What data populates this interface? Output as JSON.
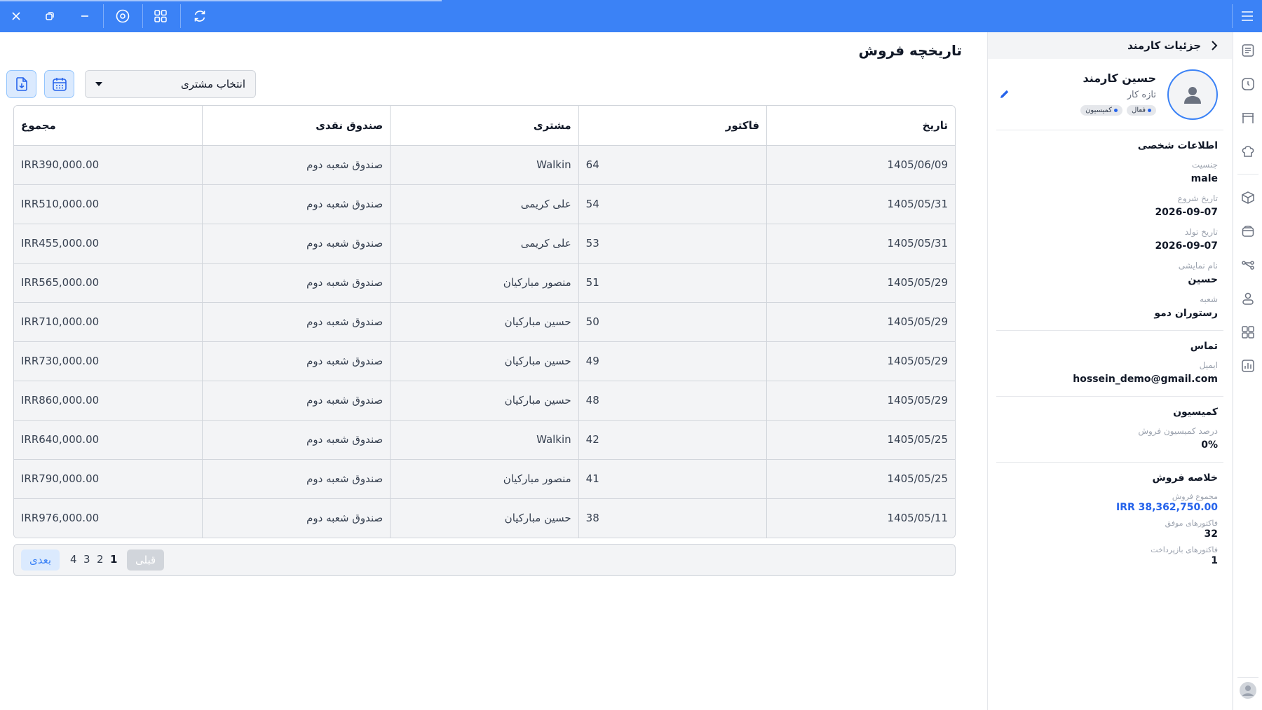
{
  "page": {
    "title": "تاریخچه فروش"
  },
  "filters": {
    "customer_select": "انتخاب مشتری"
  },
  "table": {
    "headers": {
      "date": "تاریخ",
      "invoice": "فاکتور",
      "customer": "مشتری",
      "cashbox": "صندوق نقدی",
      "total": "مجموع"
    },
    "rows": [
      {
        "date": "1405/06/09",
        "invoice": "64",
        "customer": "Walkin",
        "cashbox": "صندوق شعبه دوم",
        "total": "IRR390,000.00"
      },
      {
        "date": "1405/05/31",
        "invoice": "54",
        "customer": "علی کریمی",
        "cashbox": "صندوق شعبه دوم",
        "total": "IRR510,000.00"
      },
      {
        "date": "1405/05/31",
        "invoice": "53",
        "customer": "علی کریمی",
        "cashbox": "صندوق شعبه دوم",
        "total": "IRR455,000.00"
      },
      {
        "date": "1405/05/29",
        "invoice": "51",
        "customer": "منصور مبارکیان",
        "cashbox": "صندوق شعبه دوم",
        "total": "IRR565,000.00"
      },
      {
        "date": "1405/05/29",
        "invoice": "50",
        "customer": "حسین مبارکیان",
        "cashbox": "صندوق شعبه دوم",
        "total": "IRR710,000.00"
      },
      {
        "date": "1405/05/29",
        "invoice": "49",
        "customer": "حسین مبارکیان",
        "cashbox": "صندوق شعبه دوم",
        "total": "IRR730,000.00"
      },
      {
        "date": "1405/05/29",
        "invoice": "48",
        "customer": "حسین مبارکیان",
        "cashbox": "صندوق شعبه دوم",
        "total": "IRR860,000.00"
      },
      {
        "date": "1405/05/25",
        "invoice": "42",
        "customer": "Walkin",
        "cashbox": "صندوق شعبه دوم",
        "total": "IRR640,000.00"
      },
      {
        "date": "1405/05/25",
        "invoice": "41",
        "customer": "منصور مبارکیان",
        "cashbox": "صندوق شعبه دوم",
        "total": "IRR790,000.00"
      },
      {
        "date": "1405/05/11",
        "invoice": "38",
        "customer": "حسین مبارکیان",
        "cashbox": "صندوق شعبه دوم",
        "total": "IRR976,000.00"
      }
    ]
  },
  "pagination": {
    "prev": "قبلی",
    "next": "بعدی",
    "pages": [
      "1",
      "2",
      "3",
      "4"
    ],
    "current": "1"
  },
  "employee": {
    "panel_title": "جزئیات کارمند",
    "name": "حسین کارمند",
    "role": "تازه کار",
    "badges": [
      {
        "label": "فعال",
        "color": "#2563eb"
      },
      {
        "label": "کمیسیون",
        "color": "#2563eb"
      }
    ],
    "personal": {
      "title": "اطلاعات شخصی",
      "gender_label": "جنسیت",
      "gender": "male",
      "start_label": "تاریخ شروع",
      "start": "2026-09-07",
      "birth_label": "تاریخ تولد",
      "birth": "2026-09-07",
      "display_label": "نام نمایشی",
      "display": "حسین",
      "branch_label": "شعبه",
      "branch": "رستوران دمو"
    },
    "contact": {
      "title": "تماس",
      "email_label": "ایمیل",
      "email": "hossein_demo@gmail.com"
    },
    "commission": {
      "title": "کمیسیون",
      "rate_label": "درصد کمیسیون فروش",
      "rate": "0%"
    },
    "sales_summary": {
      "title": "خلاصه فروش",
      "total_label": "مجموع فروش",
      "total": "IRR 38,362,750.00",
      "success_label": "فاکتورهای موفق",
      "success": "32",
      "refund_label": "فاکتورهای بازپرداخت",
      "refund": "1"
    }
  },
  "colors": {
    "accent": "#3b82f6",
    "link": "#2563eb"
  },
  "icons": {
    "topbar": [
      "close-icon",
      "restore-icon",
      "minimize-icon",
      "settings-circle-icon",
      "grid-icon",
      "refresh-icon",
      "menu-icon"
    ],
    "rail": [
      "list-icon",
      "clock-icon",
      "store-icon",
      "chef-hat-icon",
      "box-icon",
      "basket-icon",
      "flow-icon",
      "user-icon",
      "apps-icon",
      "chart-icon",
      "profile-icon"
    ]
  }
}
